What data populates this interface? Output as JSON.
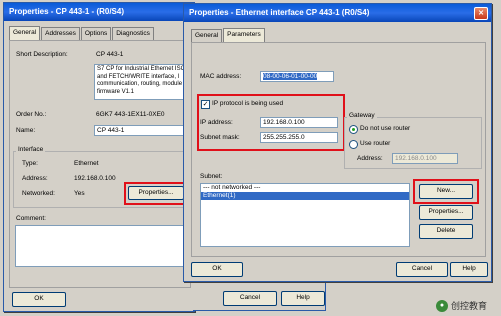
{
  "back_window": {
    "title": "Properties - CP 443-1 - (R0/S4)",
    "tabs": [
      "General",
      "Addresses",
      "Options",
      "Diagnostics"
    ],
    "short_description_label": "Short Description:",
    "short_description_name": "CP 443-1",
    "short_description_text": "S7 CP for Industrial Ethernet ISO and FETCH/WRITE interface, l communication, routing, module firmware V1.1",
    "order_no_label": "Order No.:",
    "order_no_value": "6GK7 443-1EX11-0XE0",
    "name_label": "Name:",
    "name_value": "CP 443-1",
    "interface_label": "Interface",
    "type_label": "Type:",
    "type_value": "Ethernet",
    "address_label": "Address:",
    "address_value": "192.168.0.100",
    "networked_label": "Networked:",
    "networked_value": "Yes",
    "properties_button": "Properties...",
    "comment_label": "Comment:",
    "ok_button": "OK",
    "cancel_button": "Cancel",
    "help_button": "Help"
  },
  "front_window": {
    "title": "Properties - Ethernet interface  CP 443-1 (R0/S4)",
    "tabs": [
      "General",
      "Parameters"
    ],
    "mac_label": "MAC address:",
    "mac_value": "08-00-06-01-00-00",
    "ip_checkbox_label": "IP protocol is being used",
    "ip_label": "IP address:",
    "ip_value": "192.168.0.100",
    "subnet_mask_label": "Subnet mask:",
    "subnet_mask_value": "255.255.255.0",
    "gateway_label": "Gateway",
    "gateway_option_1": "Do not use router",
    "gateway_option_2": "Use router",
    "gateway_address_label": "Address:",
    "gateway_address_value": "192.168.0.100",
    "subnet_label": "Subnet:",
    "subnet_items": [
      "--- not networked ---",
      "Ethernet(1)"
    ],
    "new_button": "New...",
    "properties_button": "Properties...",
    "delete_button": "Delete",
    "ok_button": "OK",
    "cancel_button": "Cancel",
    "help_button": "Help"
  },
  "watermark": {
    "text": "创控教育"
  },
  "colors": {
    "titlebar": "#0a5bd8",
    "highlight_box": "#e0101a",
    "selection": "#316ac5"
  }
}
